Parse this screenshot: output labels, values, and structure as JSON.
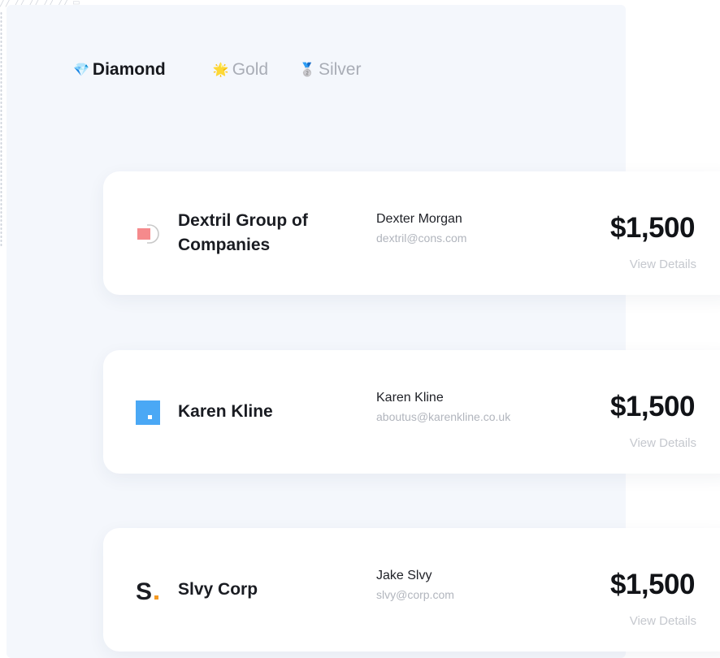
{
  "tabs": [
    {
      "label": "Diamond",
      "icon": "gem-icon",
      "emoji": "💎",
      "active": true
    },
    {
      "label": "Gold",
      "icon": "sparkle-icon",
      "emoji": "🌟",
      "active": false
    },
    {
      "label": "Silver",
      "icon": "medal-icon",
      "emoji": "🥈",
      "active": false
    }
  ],
  "sponsors": [
    {
      "company": "Dextril Group of Companies",
      "logo": "dextril-logo",
      "contact_name": "Dexter Morgan",
      "contact_email": "dextril@cons.com",
      "amount": "$1,500",
      "details_label": "View Details"
    },
    {
      "company": "Karen Kline",
      "logo": "karen-kline-logo",
      "contact_name": "Karen Kline",
      "contact_email": "aboutus@karenkline.co.uk",
      "amount": "$1,500",
      "details_label": "View Details"
    },
    {
      "company": "Slvy Corp",
      "logo": "slvy-logo",
      "logo_text": "S",
      "contact_name": "Jake Slvy",
      "contact_email": "slvy@corp.com",
      "amount": "$1,500",
      "details_label": "View Details"
    }
  ],
  "colors": {
    "panel_bg": "#f4f7fc",
    "accent_blue": "#4aa8f5",
    "accent_pink": "#f58a8c",
    "accent_orange": "#f59a23",
    "muted_text": "#a9adb6"
  }
}
